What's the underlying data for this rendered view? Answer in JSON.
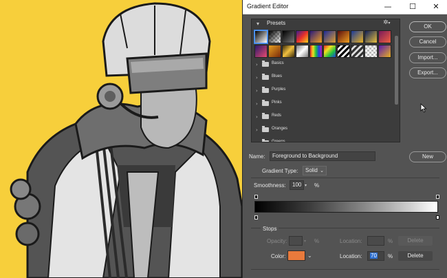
{
  "dialog": {
    "title": "Gradient Editor",
    "window_controls": {
      "minimize": "—",
      "maximize": "☐",
      "close": "✕"
    },
    "presets": {
      "label": "Presets",
      "collapse_icon": "chevron-down-icon",
      "gear_icon": "gear-icon",
      "swatches": [
        "linear-gradient(135deg,#000 0%,#fff 100%)",
        "linear-gradient(135deg,#000 0%,rgba(0,0,0,0) 100%),repeating-conic-gradient(#bbb 0% 25%,#fff 0% 50%) 0 0/6px 6px",
        "linear-gradient(135deg,#000 0%,#777 100%)",
        "linear-gradient(135deg,#3a1f8f 0%,#e8302a 50%,#f7d21c 100%)",
        "linear-gradient(135deg,#2a1a7a 0%,#f0a020 100%)",
        "linear-gradient(135deg,#1b2a9a 0%,#e0a030 100%)",
        "linear-gradient(135deg,#5a0d0d 0%,#f0a020 100%)",
        "linear-gradient(135deg,#1a3a9a 0%,#e8b020 100%)",
        "linear-gradient(135deg,#10205a 0%,#e8c040 100%)",
        "linear-gradient(135deg,#7a1a5a 0%,#f06040 100%)",
        "linear-gradient(135deg,#2a1a6a 0%,#e84a70 100%)",
        "linear-gradient(135deg,#e8a020 0%,#7a2a0a 100%)",
        "linear-gradient(135deg,#3a2a0a 0%,#f0c040 50%,#3a2a0a 100%)",
        "linear-gradient(135deg,#7a7a7a 0%,#fff 50%,#7a7a7a 100%)",
        "linear-gradient(90deg,#e82a2a,#f0e020,#20c040,#2040e0,#c020c0)",
        "linear-gradient(135deg,#e82a2a,#f0e020,#20c040,#2040e0)",
        "repeating-linear-gradient(135deg,#000 0 3px,#fff 3px 6px)",
        "repeating-linear-gradient(135deg,#333 0 3px,#ddd 3px 6px)",
        "repeating-conic-gradient(#bbb 0% 25%,#fff 0% 50%) 0 0/6px 6px",
        "linear-gradient(135deg,#5a1ab0 0%,#e8b020 100%)"
      ],
      "folders": [
        "Basics",
        "Blues",
        "Purples",
        "Pinks",
        "Reds",
        "Oranges",
        "Greens"
      ]
    },
    "buttons": {
      "ok": "OK",
      "cancel": "Cancel",
      "import": "Import...",
      "export": "Export...",
      "new": "New"
    },
    "name": {
      "label": "Name:",
      "value": "Foreground to Background"
    },
    "gradient_type": {
      "label": "Gradient Type:",
      "value": "Solid"
    },
    "smoothness": {
      "label": "Smoothness:",
      "value": "100",
      "unit": "%"
    },
    "stops": {
      "label": "Stops",
      "opacity_label": "Opacity:",
      "opacity_value": "",
      "opacity_unit": "%",
      "opacity_location_label": "Location:",
      "opacity_location_value": "",
      "location_unit": "%",
      "delete_label": "Delete",
      "color_label": "Color:",
      "color_swatch": "#e87a3c",
      "color_location_label": "Location:",
      "color_location_value": "70"
    }
  }
}
